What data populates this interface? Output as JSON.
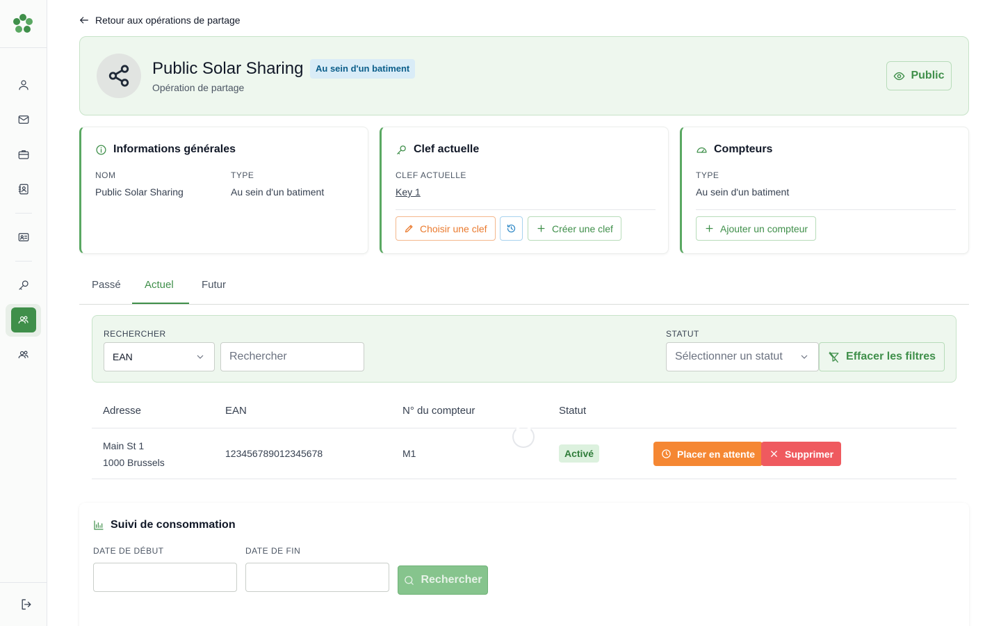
{
  "back_link": "Retour aux opérations de partage",
  "header": {
    "title": "Public Solar Sharing",
    "badge": "Au sein d'un batiment",
    "subtitle": "Opération de partage",
    "visibility_button": "Public"
  },
  "info_card": {
    "title": "Informations générales",
    "name_label": "NOM",
    "name_value": "Public Solar Sharing",
    "type_label": "TYPE",
    "type_value": "Au sein d'un batiment"
  },
  "key_card": {
    "title": "Clef actuelle",
    "key_label": "CLEF ACTUELLE",
    "key_value": "Key 1",
    "choose_button": "Choisir une clef",
    "create_button": "Créer une clef"
  },
  "meters_card": {
    "title": "Compteurs",
    "type_label": "TYPE",
    "type_value": "Au sein d'un batiment",
    "add_button": "Ajouter un compteur"
  },
  "tabs": [
    {
      "label": "Passé"
    },
    {
      "label": "Actuel"
    },
    {
      "label": "Futur"
    }
  ],
  "filters": {
    "search_label": "RECHERCHER",
    "search_field_select": "EAN",
    "search_placeholder": "Rechercher",
    "status_label": "STATUT",
    "status_placeholder": "Sélectionner un statut",
    "clear_button": "Effacer les filtres"
  },
  "table": {
    "columns": [
      "Adresse",
      "EAN",
      "N° du compteur",
      "Statut"
    ],
    "rows": [
      {
        "address_line1": "Main St 1",
        "address_line2": "1000 Brussels",
        "ean": "123456789012345678",
        "meter": "M1",
        "status": "Activé",
        "hold_button": "Placer en attente",
        "delete_button": "Supprimer"
      }
    ]
  },
  "consumption": {
    "title": "Suivi de consommation",
    "start_label": "DATE DE DÉBUT",
    "end_label": "DATE DE FIN",
    "search_button": "Rechercher"
  },
  "colors": {
    "accent": "#3f8f4a",
    "warning": "#f58733",
    "danger": "#ef5a5f",
    "info": "#2b86c5"
  }
}
